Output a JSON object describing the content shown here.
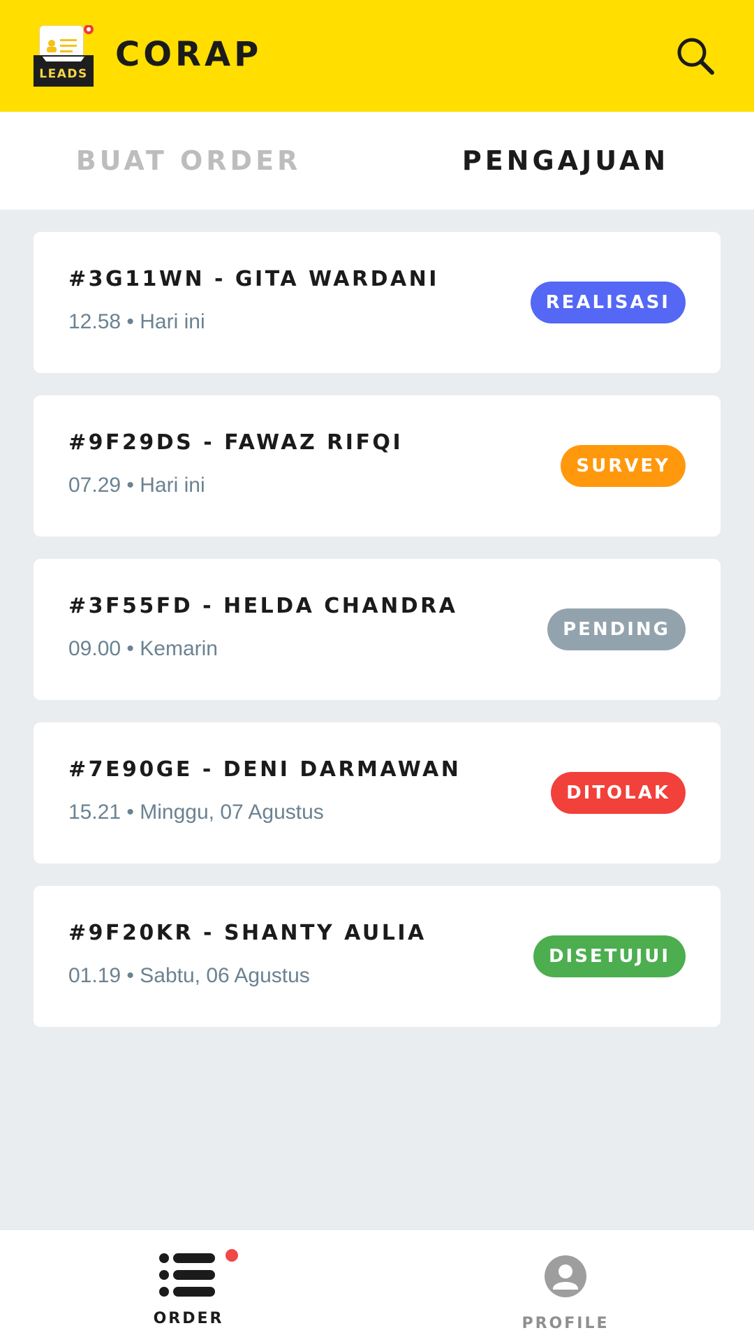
{
  "header": {
    "title": "CORAP",
    "logo_text": "LEADS",
    "logo_icon": "leads-inbox-logo",
    "search_icon": "search-icon"
  },
  "tabs": [
    {
      "label": "BUAT ORDER",
      "active": false
    },
    {
      "label": "PENGAJUAN",
      "active": true
    }
  ],
  "orders": [
    {
      "title": "#3G11WN - GITA WARDANI",
      "time": "12.58",
      "day": "Hari ini",
      "status": "REALISASI",
      "status_color": "#5467f5"
    },
    {
      "title": "#9F29DS - FAWAZ RIFQI",
      "time": "07.29",
      "day": "Hari ini",
      "status": "SURVEY",
      "status_color": "#ff980c"
    },
    {
      "title": "#3F55FD - HELDA CHANDRA",
      "time": "09.00",
      "day": "Kemarin",
      "status": "PENDING",
      "status_color": "#93a3ad"
    },
    {
      "title": "#7E90GE - DENI DARMAWAN",
      "time": "15.21",
      "day": "Minggu, 07 Agustus",
      "status": "DITOLAK",
      "status_color": "#f2403a"
    },
    {
      "title": "#9F20KR - SHANTY AULIA",
      "time": "01.19",
      "day": "Sabtu, 06 Agustus",
      "status": "DISETUJUI",
      "status_color": "#4cae4f"
    }
  ],
  "bottom_nav": {
    "order_label": "ORDER",
    "order_icon": "list-icon",
    "profile_label": "PROFILE",
    "profile_icon": "profile-icon"
  },
  "colors": {
    "header_bg": "#ffde00",
    "page_bg": "#e9edf0",
    "notification_dot": "#f04848"
  }
}
